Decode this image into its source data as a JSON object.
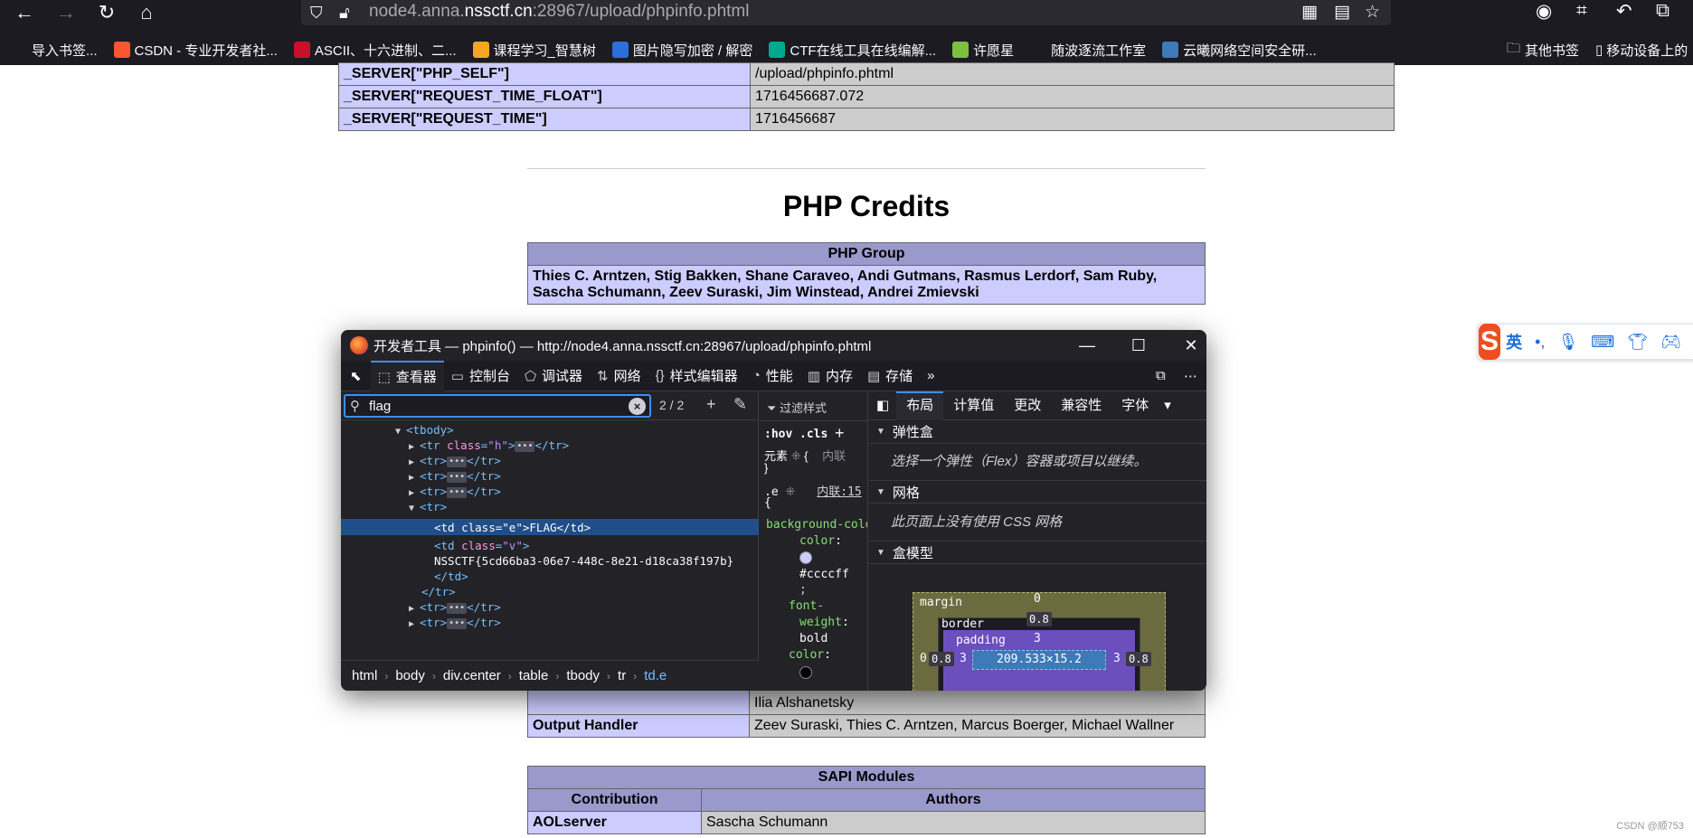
{
  "browser": {
    "url_dim": "node4.anna.",
    "url_host": "nssctf.cn",
    "url_rest": ":28967/upload/phpinfo.phtml",
    "bookmarks": [
      {
        "label": "导入书签...",
        "icon": "import-icon",
        "color": "#1c1b22"
      },
      {
        "label": "CSDN - 专业开发者社...",
        "icon": "csdn-icon",
        "color": "#fc5531"
      },
      {
        "label": "ASCII、十六进制、二...",
        "icon": "ascii-icon",
        "color": "#c8102e"
      },
      {
        "label": "课程学习_智慧树",
        "icon": "zhihuishu-icon",
        "color": "#f5a623"
      },
      {
        "label": "图片隐写加密 / 解密",
        "icon": "code-icon",
        "color": "#2a6fdb"
      },
      {
        "label": "CTF在线工具在线编解...",
        "icon": "ctf-icon",
        "color": "#00a88f"
      },
      {
        "label": "许愿星",
        "icon": "star-icon",
        "color": "#7cc142"
      },
      {
        "label": "随波逐流工作室",
        "icon": "globe-icon",
        "color": "#1c1b22"
      },
      {
        "label": "云曦网络空间安全研...",
        "icon": "yunxi-icon",
        "color": "#3d7ab8"
      }
    ],
    "other_bookmarks": "其他书签",
    "mobile_bookmarks": "移动设备上的"
  },
  "server_table": [
    {
      "key": "_SERVER[\"PHP_SELF\"]",
      "value": "/upload/phpinfo.phtml"
    },
    {
      "key": "_SERVER[\"REQUEST_TIME_FLOAT\"]",
      "value": "1716456687.072"
    },
    {
      "key": "_SERVER[\"REQUEST_TIME\"]",
      "value": "1716456687"
    }
  ],
  "credits": {
    "title": "PHP Credits",
    "group_header": "PHP Group",
    "group_members": "Thies C. Arntzen, Stig Bakken, Shane Caraveo, Andi Gutmans, Rasmus Lerdorf, Sam Ruby, Sascha Schumann, Zeev Suraski, Jim Winstead, Andrei Zmievski",
    "partial_authors": "Ilia Alshanetsky",
    "output_handler_label": "Output Handler",
    "output_handler_authors": "Zeev Suraski, Thies C. Arntzen, Marcus Boerger, Michael Wallner",
    "sapi_header": "SAPI Modules",
    "sapi_col1": "Contribution",
    "sapi_col2": "Authors",
    "sapi_row1_label": "AOLserver",
    "sapi_row1_author": "Sascha Schumann"
  },
  "devtools": {
    "title": "开发者工具 — phpinfo() — http://node4.anna.nssctf.cn:28967/upload/phpinfo.phtml",
    "tabs": [
      {
        "label": "查看器",
        "icon": "inspector-icon",
        "glyph": "⬚"
      },
      {
        "label": "控制台",
        "icon": "console-icon",
        "glyph": "▭"
      },
      {
        "label": "调试器",
        "icon": "debugger-icon",
        "glyph": "⬠"
      },
      {
        "label": "网络",
        "icon": "network-icon",
        "glyph": "⇅"
      },
      {
        "label": "样式编辑器",
        "icon": "style-editor-icon",
        "glyph": "{}"
      },
      {
        "label": "性能",
        "icon": "performance-icon",
        "glyph": "◔"
      },
      {
        "label": "内存",
        "icon": "memory-icon",
        "glyph": "▥"
      },
      {
        "label": "存储",
        "icon": "storage-icon",
        "glyph": "▤"
      }
    ],
    "search": {
      "value": "flag",
      "count": "2 / 2"
    },
    "tree": {
      "tbody_open": "<tbody>",
      "tr_h": "tr",
      "tr": "tr",
      "td_e_text": "FLAG",
      "td_v_text": "NSSCTF{5cd66ba3-06e7-448c-8e21-d18ca38f197b}",
      "class_e": "\"e\"",
      "class_v": "\"v\"",
      "class_h": "\"h\""
    },
    "breadcrumbs": [
      "html",
      "body",
      "div.center",
      "table",
      "tbody",
      "tr",
      "td.e"
    ],
    "rules": {
      "filter_placeholder": "过滤样式",
      "hov": ":hov",
      "cls": ".cls",
      "element_label": "元素",
      "inline_label": "内联",
      "selector": ".e",
      "source": "内联:15",
      "prop1": "background-color",
      "val1": "#ccccff",
      "prop2": "font-weight",
      "val2": "bold",
      "prop3": "color"
    },
    "layout": {
      "tabs": [
        "布局",
        "计算值",
        "更改",
        "兼容性",
        "字体"
      ],
      "flex_title": "弹性盒",
      "flex_note": "选择一个弹性（Flex）容器或项目以继续。",
      "grid_title": "网格",
      "grid_note": "此页面上没有使用 CSS 网格",
      "boxmodel_title": "盒模型",
      "margin_label": "margin",
      "border_label": "border",
      "padding_label": "padding",
      "margin_top": "0",
      "border_top": "0.8",
      "padding_top": "3",
      "margin_left": "0",
      "border_left": "0.8",
      "padding_left": "3",
      "padding_right": "3",
      "border_right": "0.8",
      "content_size": "209.533×15.2"
    }
  },
  "ime": {
    "mode": "英",
    "logo": "S"
  },
  "watermark": "CSDN @顺753"
}
